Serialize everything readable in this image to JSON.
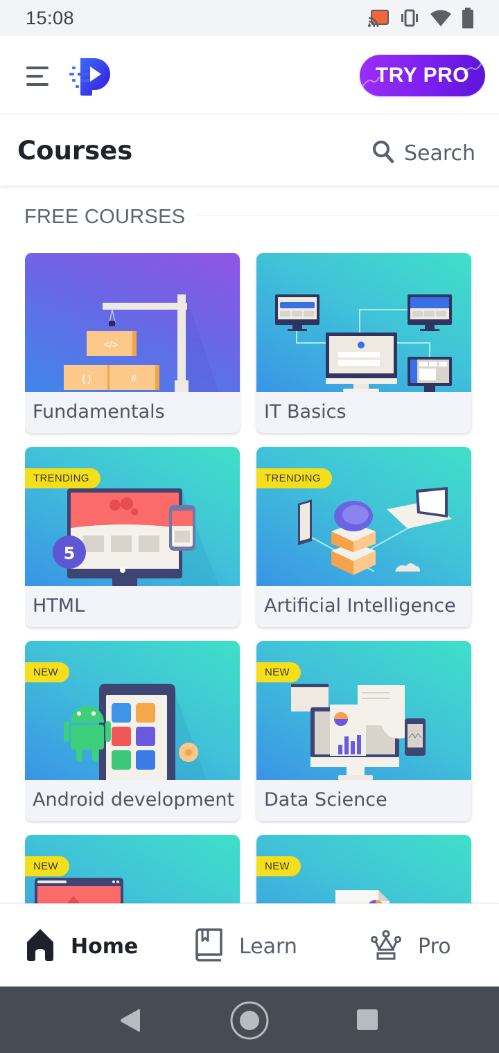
{
  "status_bar": {
    "time": "15:08",
    "icons": [
      "cast-icon",
      "vibrate-icon",
      "wifi-icon",
      "battery-icon"
    ]
  },
  "header": {
    "menu_icon": "hamburger-menu-icon",
    "logo": "app-logo-p",
    "try_pro_label": "TRY PRO"
  },
  "courses_bar": {
    "title": "Courses",
    "search_label": "Search",
    "search_icon": "search-icon"
  },
  "section": {
    "label": "FREE COURSES"
  },
  "courses": [
    {
      "title": "Fundamentals",
      "badge": null,
      "illustration": "crane-code-blocks"
    },
    {
      "title": "IT Basics",
      "badge": null,
      "illustration": "networked-computers"
    },
    {
      "title": "HTML",
      "badge": "TRENDING",
      "illustration": "html5-website"
    },
    {
      "title": "Artificial Intelligence",
      "badge": "TRENDING",
      "illustration": "ai-brain-network"
    },
    {
      "title": "Android development",
      "badge": "NEW",
      "illustration": "android-phone-apps"
    },
    {
      "title": "Data Science",
      "badge": "NEW",
      "illustration": "data-charts-monitor"
    },
    {
      "title": "",
      "badge": "NEW",
      "illustration": "browser-window"
    },
    {
      "title": "",
      "badge": "NEW",
      "illustration": "report-document"
    }
  ],
  "bottom_nav": {
    "items": [
      {
        "label": "Home",
        "icon": "home-icon",
        "active": true
      },
      {
        "label": "Learn",
        "icon": "book-icon",
        "active": false
      },
      {
        "label": "Pro",
        "icon": "crown-icon",
        "active": false
      }
    ]
  },
  "system_nav": {
    "buttons": [
      "back",
      "home",
      "recents"
    ]
  },
  "colors": {
    "accent_purple": "#7b1ff0",
    "badge_yellow": "#f5de1c",
    "logo_blue": "#3a4ff0",
    "text_dark": "#1e2129",
    "text_muted": "#5a5e6c"
  }
}
